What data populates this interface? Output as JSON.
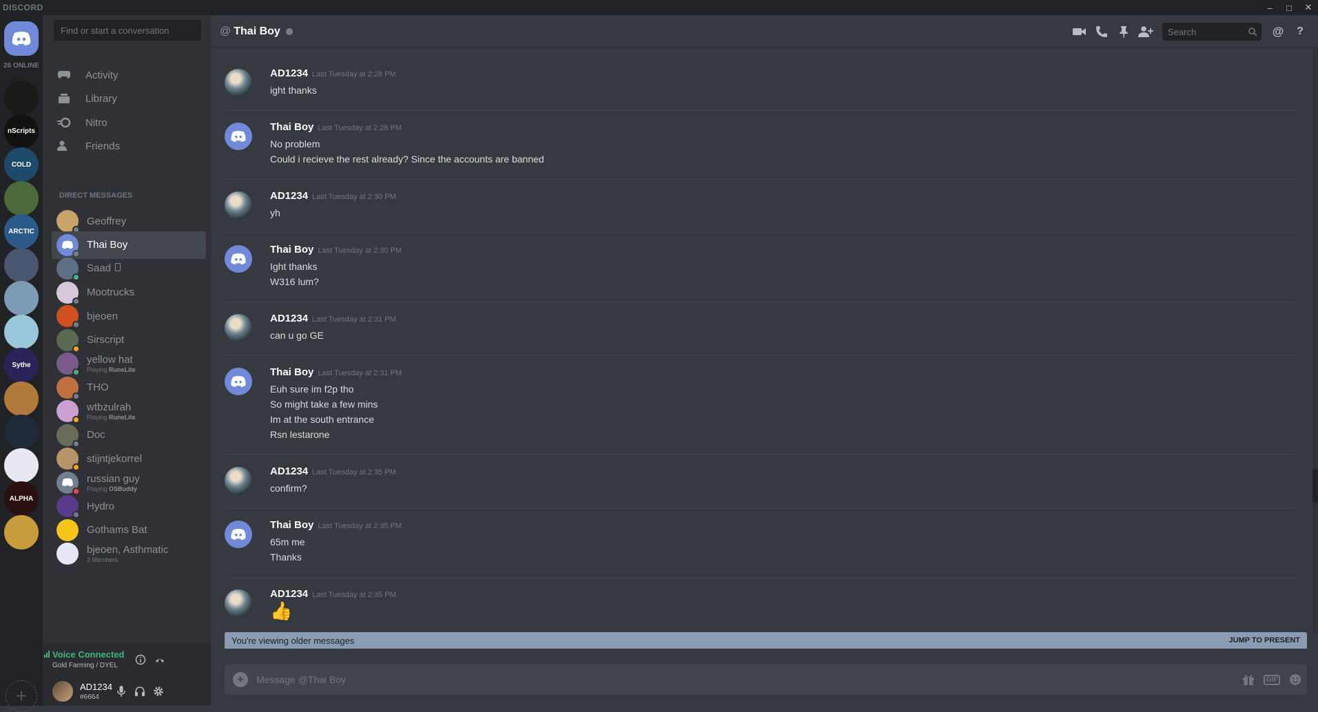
{
  "app": {
    "brand": "DISCORD"
  },
  "window_controls": [
    "–",
    "□",
    "✕"
  ],
  "guilds": {
    "online_count": "26 ONLINE",
    "items": [
      {
        "label": "",
        "color": "#1a1a1a"
      },
      {
        "label": "nScripts",
        "color": "#111111"
      },
      {
        "label": "COLD",
        "color": "#1e4a6b"
      },
      {
        "label": "",
        "color": "#4a6a3a"
      },
      {
        "label": "ARCTIC",
        "color": "#2b5a8a"
      },
      {
        "label": "",
        "color": "#4a5570"
      },
      {
        "label": "",
        "color": "#7d9bb5"
      },
      {
        "label": "",
        "color": "#9ac7d9"
      },
      {
        "label": "Sythe",
        "color": "#2a2458"
      },
      {
        "label": "",
        "color": "#b07b3a"
      },
      {
        "label": "",
        "color": "#1f2a38"
      },
      {
        "label": "",
        "color": "#e8e8f0"
      },
      {
        "label": "ALPHA",
        "color": "#2a1010"
      },
      {
        "label": "",
        "color": "#c89b3c"
      }
    ]
  },
  "sidebar": {
    "search_placeholder": "Find or start a conversation",
    "nav": [
      {
        "label": "Activity",
        "icon": "gamepad-icon"
      },
      {
        "label": "Library",
        "icon": "library-icon"
      },
      {
        "label": "Nitro",
        "icon": "nitro-icon"
      },
      {
        "label": "Friends",
        "icon": "friends-icon"
      }
    ],
    "dm_header": "DIRECT MESSAGES",
    "dms": [
      {
        "name": "Geoffrey",
        "status": "#747f8d",
        "avatar": "#c9a36a"
      },
      {
        "name": "Thai Boy",
        "status": "#747f8d",
        "avatar": "#7289da",
        "active": true
      },
      {
        "name": "Saad",
        "status": "#43b581",
        "avatar": "#5c6f84",
        "mobile": true
      },
      {
        "name": "Mootrucks",
        "status": "#747f8d",
        "avatar": "#d6c7d9"
      },
      {
        "name": "bjeoen",
        "status": "#747f8d",
        "avatar": "#d1501f"
      },
      {
        "name": "Sirscript",
        "status": "#faa61a",
        "avatar": "#5a6b52"
      },
      {
        "name": "yellow hat",
        "status": "#43b581",
        "avatar": "#7a5a8a",
        "activity_prefix": "Playing",
        "activity": "RuneLite"
      },
      {
        "name": "THO",
        "status": "#747f8d",
        "avatar": "#c07040"
      },
      {
        "name": "wtbzulrah",
        "status": "#faa61a",
        "avatar": "#c9a0d0",
        "activity_prefix": "Playing",
        "activity": "RuneLite"
      },
      {
        "name": "Doc",
        "status": "#747f8d",
        "avatar": "#6b6b5a"
      },
      {
        "name": "stijntjekorrel",
        "status": "#faa61a",
        "avatar": "#b8946a"
      },
      {
        "name": "russian guy",
        "status": "#f04747",
        "avatar": "#747f8d",
        "activity_prefix": "Playing",
        "activity": "OSBuddy"
      },
      {
        "name": "Hydro",
        "status": "#747f8d",
        "avatar": "#5a3a8a"
      },
      {
        "name": "Gothams Bat",
        "status": "",
        "avatar": "#f5c518"
      },
      {
        "name": "bjeoen, Asthmatic",
        "status": "",
        "avatar": "#e6e6f5",
        "sub": "3 Members"
      }
    ],
    "voice": {
      "title": "Voice Connected",
      "sub": "Gold Farming / DYEL"
    },
    "user": {
      "name": "AD1234",
      "discriminator": "#6664"
    }
  },
  "chat": {
    "at": "@",
    "title": "Thai Boy",
    "search_placeholder": "Search",
    "messages": [
      {
        "author": "AD1234",
        "time": "Last Tuesday at 2:28 PM",
        "av": "ad",
        "lines": [
          "ight thanks"
        ]
      },
      {
        "author": "Thai Boy",
        "time": "Last Tuesday at 2:28 PM",
        "av": "tb",
        "lines": [
          "No problem",
          "Could i recieve the rest already? Since the accounts are banned"
        ]
      },
      {
        "author": "AD1234",
        "time": "Last Tuesday at 2:30 PM",
        "av": "ad",
        "lines": [
          "yh"
        ]
      },
      {
        "author": "Thai Boy",
        "time": "Last Tuesday at 2:30 PM",
        "av": "tb",
        "lines": [
          "Ight thanks",
          "W316 lum?"
        ]
      },
      {
        "author": "AD1234",
        "time": "Last Tuesday at 2:31 PM",
        "av": "ad",
        "lines": [
          "can u go GE"
        ]
      },
      {
        "author": "Thai Boy",
        "time": "Last Tuesday at 2:31 PM",
        "av": "tb",
        "lines": [
          "Euh sure im f2p tho",
          "So might take a few mins",
          "Im at the south entrance",
          "Rsn lestarone"
        ]
      },
      {
        "author": "AD1234",
        "time": "Last Tuesday at 2:35 PM",
        "av": "ad",
        "lines": [
          "confirm?"
        ]
      },
      {
        "author": "Thai Boy",
        "time": "Last Tuesday at 2:35 PM",
        "av": "tb",
        "lines": [
          "65m me",
          "Thanks"
        ]
      },
      {
        "author": "AD1234",
        "time": "Last Tuesday at 2:35 PM",
        "av": "ad",
        "lines": [
          "👍"
        ]
      }
    ],
    "older_notice": "You're viewing older messages",
    "jump_label": "JUMP TO PRESENT",
    "composer_placeholder": "Message @Thai Boy",
    "gif_label": "GIF"
  }
}
